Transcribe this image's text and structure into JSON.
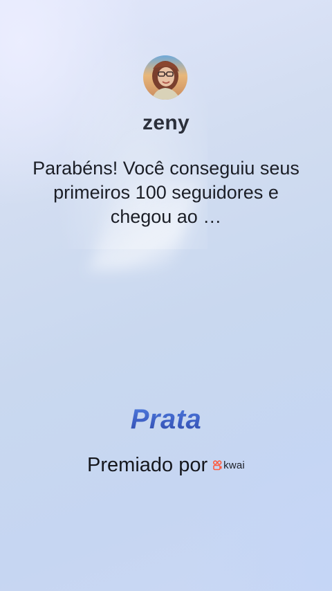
{
  "profile": {
    "username": "zeny",
    "avatar_icon": "user-avatar-photo"
  },
  "message": {
    "text": "Parabéns! Você conseguiu seus primeiros 100 seguidores e chegou ao …"
  },
  "badge": {
    "title": "Prata",
    "color": "#3c5dc2"
  },
  "footer": {
    "awarded_by": "Premiado por",
    "brand_name": "kwai",
    "brand_icon": "kwai-logo-icon",
    "brand_color": "#ff5a3c"
  },
  "colors": {
    "background": "#cbd8f0",
    "text": "#1b1e26"
  }
}
